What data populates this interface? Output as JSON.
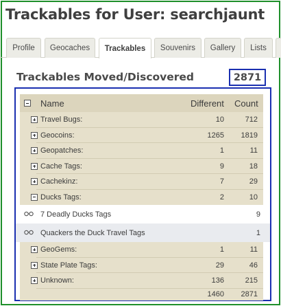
{
  "page": {
    "title": "Trackables for User: searchjaunt"
  },
  "tabs": [
    {
      "label": "Profile",
      "active": false
    },
    {
      "label": "Geocaches",
      "active": false
    },
    {
      "label": "Trackables",
      "active": true
    },
    {
      "label": "Souvenirs",
      "active": false
    },
    {
      "label": "Gallery",
      "active": false
    },
    {
      "label": "Lists",
      "active": false
    }
  ],
  "section": {
    "title": "Trackables Moved/Discovered",
    "total": "2871"
  },
  "table": {
    "headers": {
      "name": "Name",
      "different": "Different",
      "count": "Count"
    },
    "rows": [
      {
        "name": "Travel Bugs:",
        "different": "10",
        "count": "712",
        "toggle": "plus"
      },
      {
        "name": "Geocoins:",
        "different": "1265",
        "count": "1819",
        "toggle": "plus"
      },
      {
        "name": "Geopatches:",
        "different": "1",
        "count": "11",
        "toggle": "plus"
      },
      {
        "name": "Cache Tags:",
        "different": "9",
        "count": "18",
        "toggle": "plus"
      },
      {
        "name": "Cachekinz:",
        "different": "7",
        "count": "29",
        "toggle": "plus"
      },
      {
        "name": "Ducks Tags:",
        "different": "2",
        "count": "10",
        "toggle": "minus"
      }
    ],
    "sub_rows": [
      {
        "name": "7 Deadly Ducks Tags",
        "count": "9",
        "icon": "glasses-icon"
      },
      {
        "name": "Quackers the Duck Travel Tags",
        "count": "1",
        "icon": "glasses-icon"
      }
    ],
    "rows_after": [
      {
        "name": "GeoGems:",
        "different": "1",
        "count": "11",
        "toggle": "plus"
      },
      {
        "name": "State Plate Tags:",
        "different": "29",
        "count": "46",
        "toggle": "plus"
      },
      {
        "name": "Unknown:",
        "different": "136",
        "count": "215",
        "toggle": "plus"
      }
    ],
    "totals": {
      "different": "1460",
      "count": "2871"
    }
  },
  "colors": {
    "frame": "#1e8f2a",
    "highlight_box": "#1a2fb0",
    "table_header": "#dcd5bd",
    "table_row": "#e6e0cb"
  }
}
